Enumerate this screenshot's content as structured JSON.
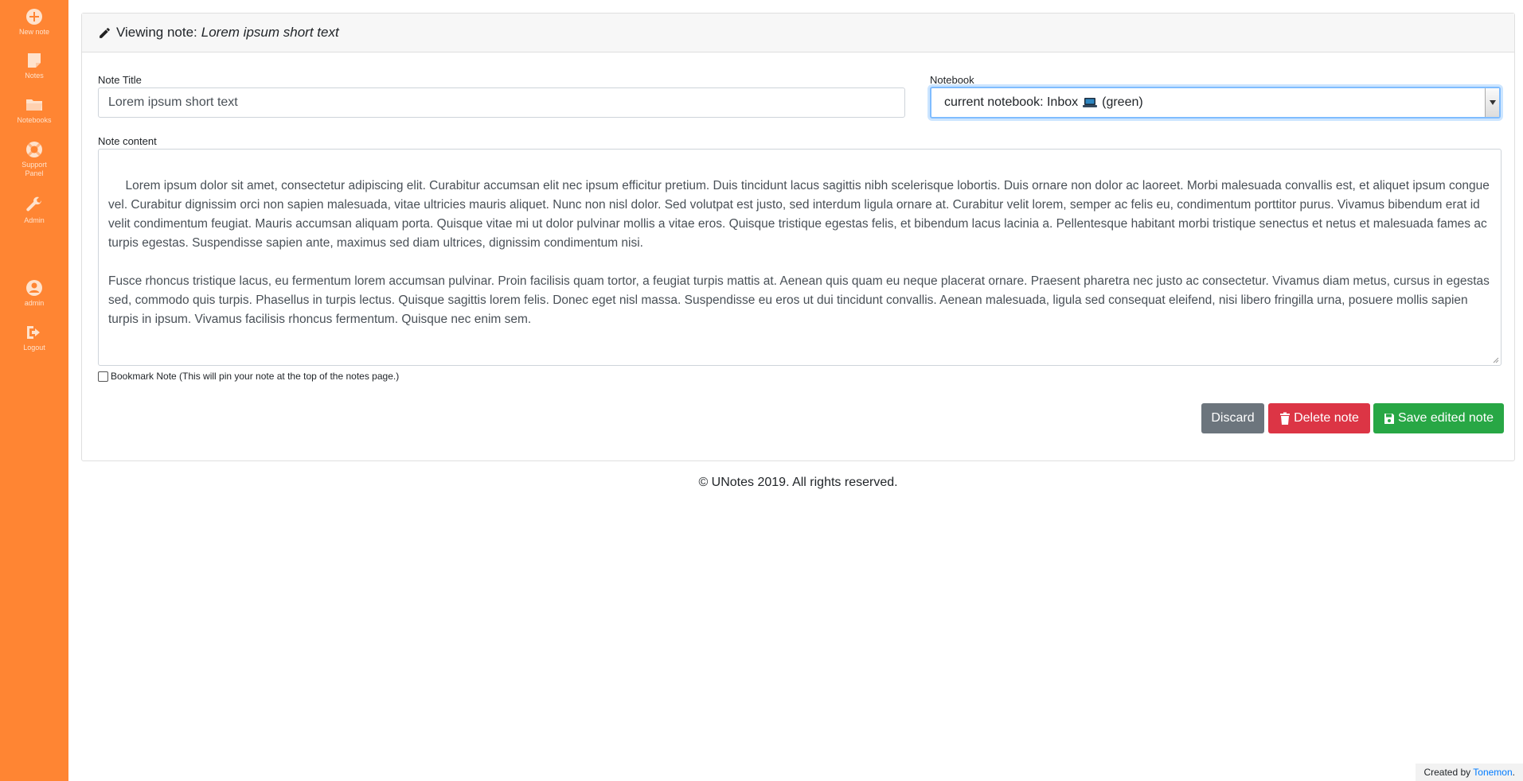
{
  "sidebar": {
    "items": [
      {
        "label": "New note",
        "icon": "plus-circle-icon"
      },
      {
        "label": "Notes",
        "icon": "note-icon"
      },
      {
        "label": "Notebooks",
        "icon": "folder-icon"
      },
      {
        "label": "Support Panel",
        "icon": "life-ring-icon"
      },
      {
        "label": "Admin",
        "icon": "wrench-icon"
      },
      {
        "label": "admin",
        "icon": "user-icon"
      },
      {
        "label": "Logout",
        "icon": "logout-icon"
      }
    ]
  },
  "header": {
    "prefix": "Viewing note:",
    "note_title": "Lorem ipsum short text"
  },
  "form": {
    "title_label": "Note Title",
    "title_value": "Lorem ipsum short text",
    "notebook_label": "Notebook",
    "notebook_value_prefix": "current notebook: Inbox",
    "notebook_value_suffix": "(green)",
    "content_label": "Note content",
    "content_value": " Lorem ipsum dolor sit amet, consectetur adipiscing elit. Curabitur accumsan elit nec ipsum efficitur pretium. Duis tincidunt lacus sagittis nibh scelerisque lobortis. Duis ornare non dolor ac laoreet. Morbi malesuada convallis est, et aliquet ipsum congue vel. Curabitur dignissim orci non sapien malesuada, vitae ultricies mauris aliquet. Nunc non nisl dolor. Sed volutpat est justo, sed interdum ligula ornare at. Curabitur velit lorem, semper ac felis eu, condimentum porttitor purus. Vivamus bibendum erat id velit condimentum feugiat. Mauris accumsan aliquam porta. Quisque vitae mi ut dolor pulvinar mollis a vitae eros. Quisque tristique egestas felis, et bibendum lacus lacinia a. Pellentesque habitant morbi tristique senectus et netus et malesuada fames ac turpis egestas. Suspendisse sapien ante, maximus sed diam ultrices, dignissim condimentum nisi.\n\nFusce rhoncus tristique lacus, eu fermentum lorem accumsan pulvinar. Proin facilisis quam tortor, a feugiat turpis mattis at. Aenean quis quam eu neque placerat ornare. Praesent pharetra nec justo ac consectetur. Vivamus diam metus, cursus in egestas sed, commodo quis turpis. Phasellus in turpis lectus. Quisque sagittis lorem felis. Donec eget nisl massa. Suspendisse eu eros ut dui tincidunt convallis. Aenean malesuada, ligula sed consequat eleifend, nisi libero fringilla urna, posuere mollis sapien turpis in ipsum. Vivamus facilisis rhoncus fermentum. Quisque nec enim sem.",
    "bookmark_label": "Bookmark Note (This will pin your note at the top of the notes page.)",
    "bookmark_checked": false
  },
  "actions": {
    "discard_label": "Discard",
    "delete_label": "Delete note",
    "save_label": "Save edited note"
  },
  "footer": {
    "copyright": "© UNotes 2019. All rights reserved.",
    "credit_prefix": "Created by",
    "credit_link": "Tonemon",
    "credit_suffix": "."
  },
  "colors": {
    "sidebar": "#ff8533",
    "discard": "#6c757d",
    "delete": "#dc3545",
    "save": "#28a745",
    "focus": "#80bdff"
  }
}
